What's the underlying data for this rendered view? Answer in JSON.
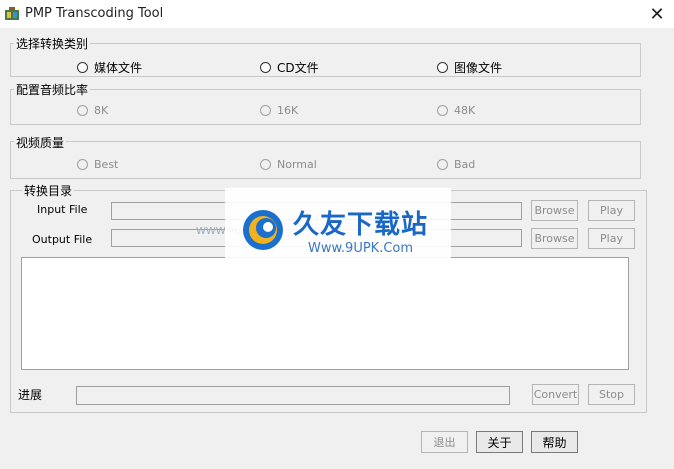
{
  "window": {
    "title": "PMP Transcoding Tool",
    "close_glyph": "✕"
  },
  "category_group": {
    "legend": "选择转换类别",
    "options": [
      "媒体文件",
      "CD文件",
      "图像文件"
    ]
  },
  "bitrate_group": {
    "legend": "配置音频比率",
    "options": [
      "8K",
      "16K",
      "48K"
    ]
  },
  "quality_group": {
    "legend": "视频质量",
    "options": [
      "Best",
      "Normal",
      "Bad"
    ]
  },
  "dir_group": {
    "legend": "转换目录",
    "input_label": "Input File",
    "output_label": "Output File",
    "input_value": "",
    "output_value": "",
    "browse_label": "Browse",
    "play_label": "Play"
  },
  "progress": {
    "label": "进展",
    "value": 0,
    "convert_label": "Convert",
    "stop_label": "Stop"
  },
  "footer": {
    "exit_label": "退出",
    "about_label": "关于",
    "help_label": "帮助"
  },
  "watermark": {
    "main": "久友下载站",
    "sub": "Www.9UPK.Com",
    "side": "WWW.9UPK.COM"
  }
}
